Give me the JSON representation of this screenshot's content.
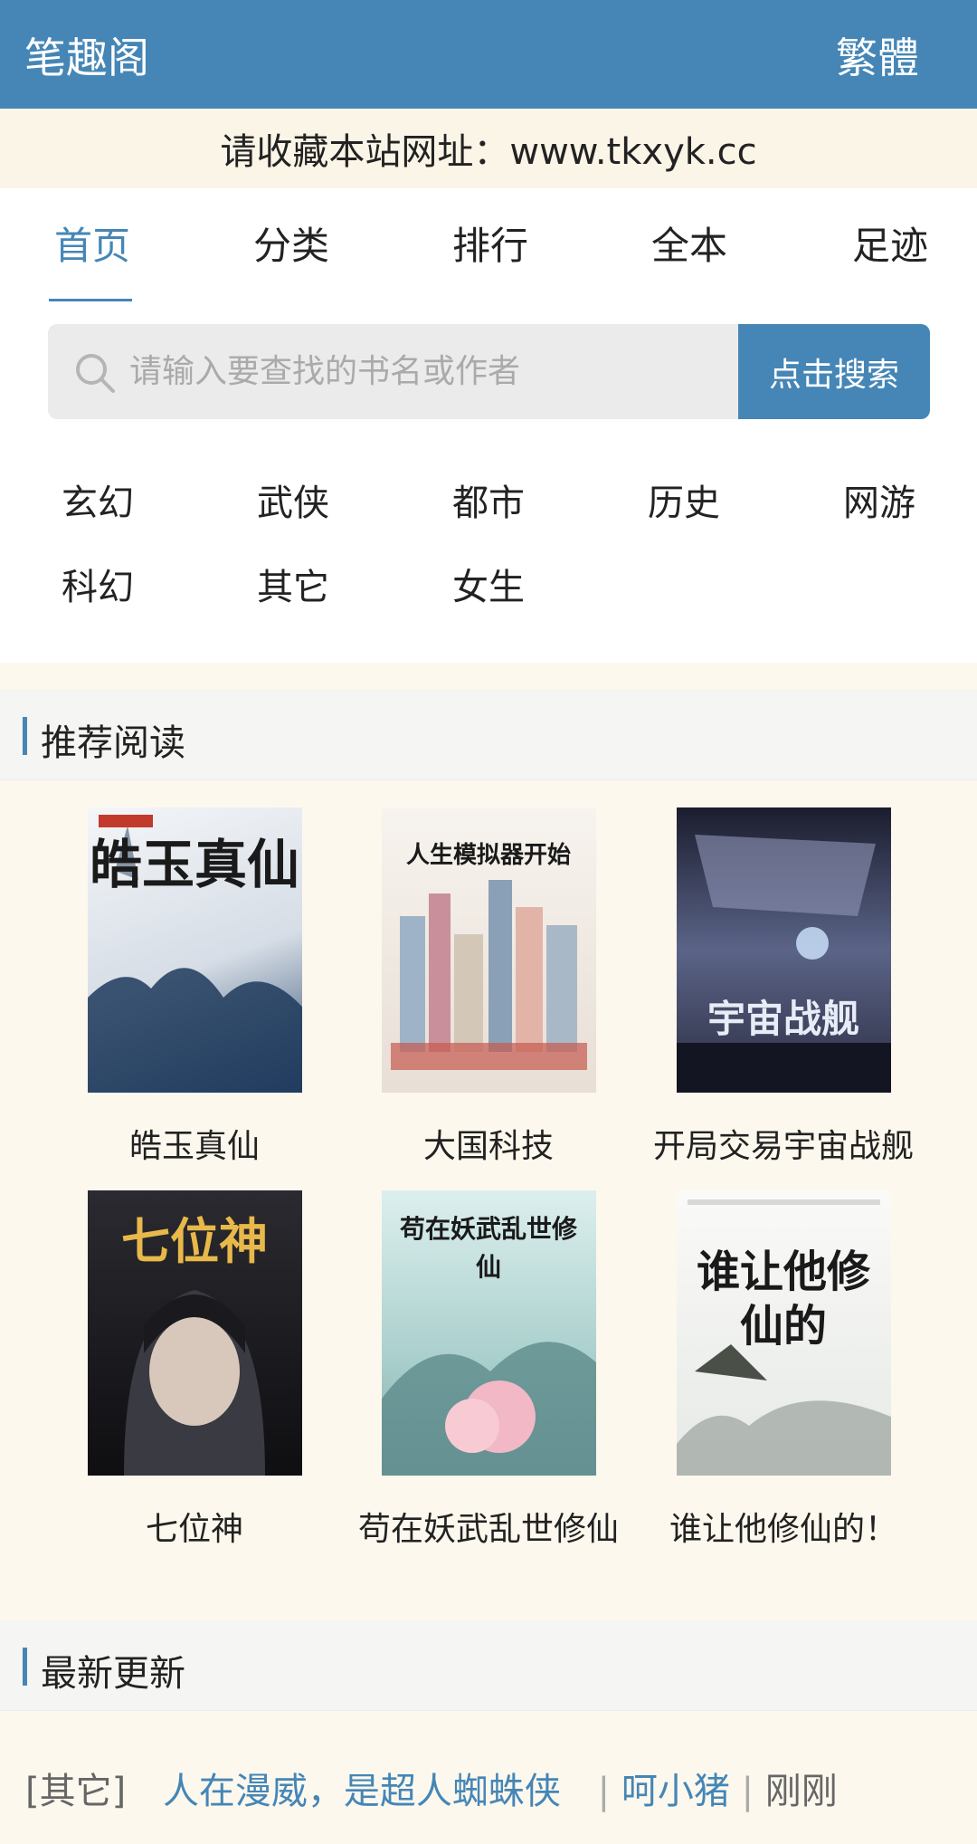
{
  "header": {
    "brand": "笔趣阁",
    "lang_toggle": "繁體"
  },
  "notice": "请收藏本站网址：www.tkxyk.cc",
  "nav": [
    {
      "label": "首页",
      "active": true
    },
    {
      "label": "分类",
      "active": false
    },
    {
      "label": "排行",
      "active": false
    },
    {
      "label": "全本",
      "active": false
    },
    {
      "label": "足迹",
      "active": false
    }
  ],
  "search": {
    "placeholder": "请输入要查找的书名或作者",
    "button": "点击搜索"
  },
  "categories": [
    "玄幻",
    "武侠",
    "都市",
    "历史",
    "网游",
    "科幻",
    "其它",
    "女生"
  ],
  "recommend": {
    "title": "推荐阅读",
    "books": [
      {
        "title": "皓玉真仙",
        "cover_text": "皓玉真仙",
        "cover_color": "#e8ecf0"
      },
      {
        "title": "大国科技",
        "cover_text": "人生模拟器开始",
        "cover_color": "#f1ece6"
      },
      {
        "title": "开局交易宇宙战舰",
        "cover_text": "宇宙战舰",
        "cover_color": "#3a3a5a"
      },
      {
        "title": "七位神",
        "cover_text": "七位神",
        "cover_color": "#1e1e22"
      },
      {
        "title": "苟在妖武乱世修仙",
        "cover_text": "苟在妖武乱世修仙",
        "cover_color": "#cfe4e2"
      },
      {
        "title": "谁让他修仙的！",
        "cover_text": "谁让他修仙的",
        "cover_color": "#f4f4f2"
      }
    ]
  },
  "latest": {
    "title": "最新更新",
    "item": {
      "tag": "[其它]",
      "book": "人在漫威，是超人蜘蛛侠",
      "author": "呵小猪",
      "time": "刚刚",
      "sep": "|"
    }
  },
  "colors": {
    "accent": "#4586b6",
    "background": "#fdf8ee"
  }
}
